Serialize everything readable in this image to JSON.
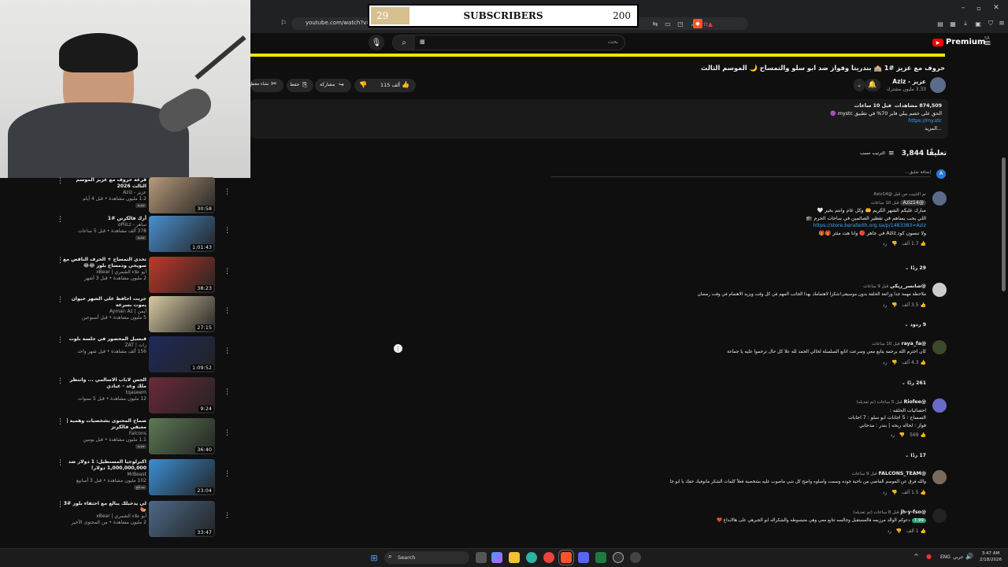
{
  "browser": {
    "url": "youtube.com/watch?v=P",
    "url_extra": "2302s"
  },
  "overlay": {
    "left_value": "29",
    "label": "SUBSCRIBERS",
    "right_value": "200",
    "progress_fraction": 0.145
  },
  "youtube": {
    "premium_label": "Premium",
    "premium_region": "SA",
    "search_placeholder": "بحث",
    "search_value": "▩",
    "video_title": "حروف مع عزيز #1 🏫 بندريتا وفواز ضد ابو سلو والتمساح 🌙 الموسم الثالث",
    "channel_name": "عزيز - Aziz",
    "channel_subs": "3.33 مليون مشترك",
    "likes": "115 ألف",
    "share_label": "مشاركة",
    "save_label": "حفظ",
    "clip_label": "إنشاء مقطع",
    "description": {
      "meta_views": "874,509 مشاهدات",
      "meta_time": "قبل 10 ساعات",
      "line1": "الحق على خصم يبلي فاير 70% في تطبيق mystc 🟣",
      "link": "https://my.stc",
      "more": "...المزيد"
    },
    "comments_header": {
      "count": "3,844 تعليقًا",
      "sort": "الترتيب حسب"
    },
    "add_comment": "إضافة تعليق...",
    "comments": [
      {
        "pinned": "تم التثبيت من قبل @Aziz14",
        "author": "@Aziz14",
        "time": "قبل 10 ساعات",
        "lines": [
          "مبارك عليكم الشهر الكريم 🤲 وكل عام وانتم بخير 🤍",
          "اللي يحب يساهم في تفطير الصائمين في ساحات الحرم 🕋",
          "https://store.beralleith.org.sa/p/1483383=Aziz",
          "ولا تنسون كود Aziz في جاهز 🔴 وانا هت مثثر 🎁🎁"
        ],
        "likes": "1.7 ألف",
        "reply": "رد",
        "replies_count": "29 ردًا"
      },
      {
        "author": "@شانسر_ريكي",
        "time": "قبل 9 ساعات",
        "lines": [
          "ملاحظة مهمة جدا ورائعة الحلقة بدون موسيقى!شكرا لاهتمامك بهذا الجانب المهم في كل وقت ويزيد الاهتمام في وقت رمضان"
        ],
        "likes": "3.5 ألف",
        "reply": "رد",
        "replies_count": "9 ردود"
      },
      {
        "author": "@raya_fa",
        "time": "قبل 10 ساعات",
        "lines": [
          "كان احترم الله يرحمه يتابع معي وسرعت اتابع السلسلة لحالي الحمد لله علا كل حال ترحموا عليه يا جماعة"
        ],
        "likes": "4.3 ألف",
        "reply": "رد",
        "replies_count": "261 ردًا"
      },
      {
        "author": "@Riofee",
        "time": "قبل 5 ساعات (تم تعديله)",
        "lines": [
          "احصائيات الحلقه :",
          "التمساح : 5 اجابات ابو سلو : 7 اجابات",
          "فواز : لحاله ربحه | بندر : مدحاني"
        ],
        "likes": "569",
        "reply": "رد",
        "replies_count": "17 ردًا"
      },
      {
        "author": "@FALCONS_TEAM",
        "time": "قبل 9 ساعات",
        "lines": [
          "والله فرق عن الموسم الماضي من ناحية جوده وسمت واسلوه واضح كل شي ماصوب عليه بشخصية فعلاً كلمات الشكر ماتوفيك حقك يا ابو جا"
        ],
        "likes": "1.5 ألف",
        "reply": "رد"
      },
      {
        "author": "@jh-y-fso",
        "time": "قبل 8 ساعات (تم تعديله)",
        "badge": "7.99",
        "lines": [
          "دعوكم الوالد مرزيمه فالمستقبل وجالسه تتابع معي وهي متبسوطه والشكراله ابو الجبرهي علی هالابداع ❤️"
        ],
        "likes": "1 ألف",
        "reply": "رد"
      }
    ],
    "recommendations": [
      {
        "title": "قرعة حروف مع عزيز الموسم الثالث 2026",
        "channel": "عزيز - Aziz",
        "meta": "1.2 مليون مشاهدة • قبل 4 أيام",
        "badge": "جديد",
        "duration": "30:58",
        "thumb_color": "#b89a7a"
      },
      {
        "title": "أرك فالكرتن #1",
        "channel": "ساهر - oPiiLz",
        "meta": "378 ألف مشاهدة • قبل 5 ساعات",
        "badge": "جديد",
        "duration": "1:01:43",
        "thumb_color": "#4a8fd0"
      },
      {
        "title": "تحدي التمساح + الحرف الناقص مع سويحي ودمساح بلوز 😂😂",
        "channel": "أبو علاء الشمري | xBear",
        "meta": "2 مليون مشاهدة • قبل 3 أشهر",
        "badge": "",
        "duration": "38:23",
        "thumb_color": "#c0392b"
      },
      {
        "title": "جربت احافظ على الشهر حيوان يموت بسرعة",
        "channel": "أيمن | Ayman Az",
        "meta": "5 مليون مشاهدة • قبل أسبوعين",
        "badge": "",
        "duration": "27:15",
        "thumb_color": "#d9c9a3"
      },
      {
        "title": "قبسيل المحصور في جلسة بلوت",
        "channel": "زات | ZAT",
        "meta": "156 ألف مشاهدة • قبل شهر واحد",
        "badge": "",
        "duration": "1:09:52",
        "thumb_color": "#1f2a5a"
      },
      {
        "title": "الحس لاباب الاسالمي ... وانتظر ملك وعد - عيادي",
        "channel": "tqaseem",
        "meta": "12 مليون مشاهدة • قبل 5 سنوات",
        "badge": "",
        "duration": "9:24",
        "thumb_color": "#6b2a3a"
      },
      {
        "title": "صماخ المحتوى بشخصيات وهمية | معبقي فالكرتز",
        "channel": "Falcons",
        "meta": "1.1 مليون مشاهدة • قبل يومين",
        "badge": "جديد",
        "duration": "36:40",
        "thumb_color": "#5c7a54"
      },
      {
        "title": "اكبرلوجيا المستطيل: 1 دولار ضد 1,000,000,000 دولار!",
        "channel": "MrBeast",
        "meta": "102 مليون مشاهدة • قبل 3 أسابيع",
        "badge": "مدبلج",
        "duration": "23:04",
        "thumb_color": "#3a8fd6"
      },
      {
        "title": "لي يدخبلك يبالع مع احتفاء بلوز #3 🍉",
        "channel": "أبو علاء الشمري | xBear",
        "meta": "2 مليون مشاهدة • من المحتوى الأخير",
        "badge": "",
        "duration": "33:47",
        "thumb_color": "#4c6a8a"
      }
    ]
  },
  "taskbar": {
    "search_label": "Search",
    "lang": "ENG",
    "lang2": "عربي",
    "time": "3:47 AM",
    "date": "2/18/2026"
  },
  "colors": {
    "accent_yellow": "#f2e20a",
    "yt_red": "#ff0000",
    "bg": "#0f0f0f"
  }
}
